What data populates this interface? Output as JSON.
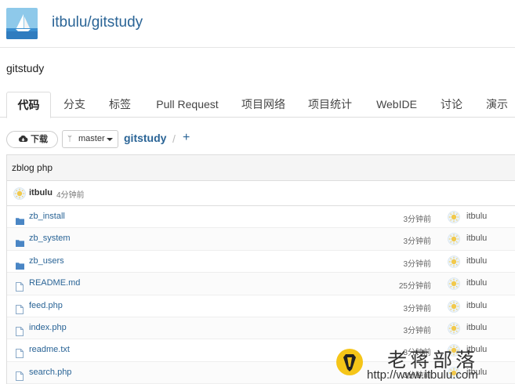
{
  "repo": {
    "path": "itbulu/gitstudy",
    "description": "gitstudy"
  },
  "tabs": [
    {
      "label": "代码",
      "active": true
    },
    {
      "label": "分支"
    },
    {
      "label": "标签"
    },
    {
      "label": "Pull Request"
    },
    {
      "label": "项目网络"
    },
    {
      "label": "项目统计"
    },
    {
      "label": "WebIDE"
    },
    {
      "label": "讨论"
    },
    {
      "label": "演示"
    }
  ],
  "toolbar": {
    "download_label": "下载",
    "branch": "master",
    "crumb_repo": "gitstudy",
    "crumb_sep": "/",
    "crumb_add": "+"
  },
  "commit": {
    "message": "zblog php",
    "author": "itbulu",
    "time": "4分钟前"
  },
  "files": [
    {
      "name": "zb_install",
      "type": "folder",
      "time": "3分钟前",
      "author": "itbulu"
    },
    {
      "name": "zb_system",
      "type": "folder",
      "time": "3分钟前",
      "author": "itbulu"
    },
    {
      "name": "zb_users",
      "type": "folder",
      "time": "3分钟前",
      "author": "itbulu"
    },
    {
      "name": "README.md",
      "type": "file",
      "time": "25分钟前",
      "author": "itbulu"
    },
    {
      "name": "feed.php",
      "type": "file",
      "time": "3分钟前",
      "author": "itbulu"
    },
    {
      "name": "index.php",
      "type": "file",
      "time": "3分钟前",
      "author": "itbulu"
    },
    {
      "name": "readme.txt",
      "type": "file",
      "time": "3分钟前",
      "author": "itbulu"
    },
    {
      "name": "search.php",
      "type": "file",
      "time": "3分钟前",
      "author": "itbulu"
    }
  ],
  "watermark": {
    "title": "老蒋部落",
    "url": "http://www.itbulu.com"
  },
  "colors": {
    "link": "#2a6496",
    "folder_icon": "#4a86c5",
    "avatar_sun": "#f2c94c"
  }
}
